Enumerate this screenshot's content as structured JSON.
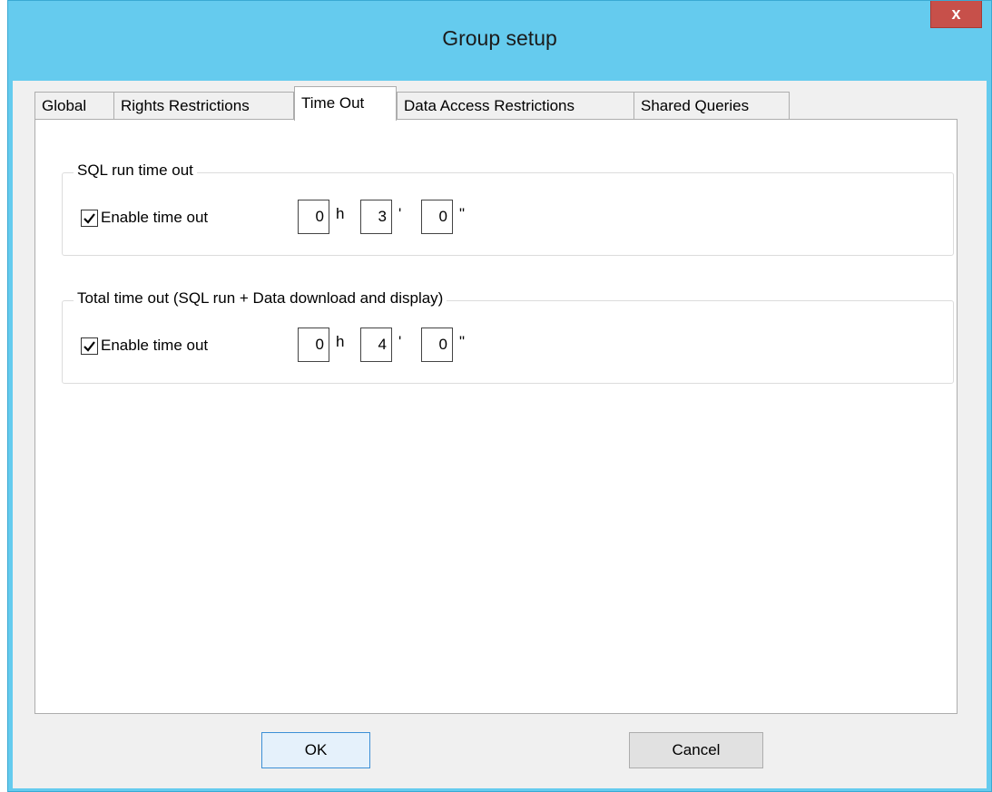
{
  "window": {
    "title": "Group setup",
    "close_label": "x"
  },
  "tabs": [
    {
      "label": "Global"
    },
    {
      "label": "Rights Restrictions"
    },
    {
      "label": "Time Out"
    },
    {
      "label": "Data Access Restrictions"
    },
    {
      "label": "Shared Queries"
    }
  ],
  "active_tab": "Time Out",
  "sql_timeout": {
    "legend": "SQL run time out",
    "checkbox_label": "Enable time out",
    "enabled": true,
    "hours": "0",
    "minutes": "3",
    "seconds": "0",
    "hours_unit": "h",
    "minutes_unit": "'",
    "seconds_unit": "\""
  },
  "total_timeout": {
    "legend": "Total time out (SQL run + Data download and display)",
    "checkbox_label": "Enable time out",
    "enabled": true,
    "hours": "0",
    "minutes": "4",
    "seconds": "0",
    "hours_unit": "h",
    "minutes_unit": "'",
    "seconds_unit": "\""
  },
  "buttons": {
    "ok": "OK",
    "cancel": "Cancel"
  },
  "colors": {
    "titlebar": "#65cbee",
    "close": "#c7504a",
    "default_button_border": "#3c8fd6"
  }
}
